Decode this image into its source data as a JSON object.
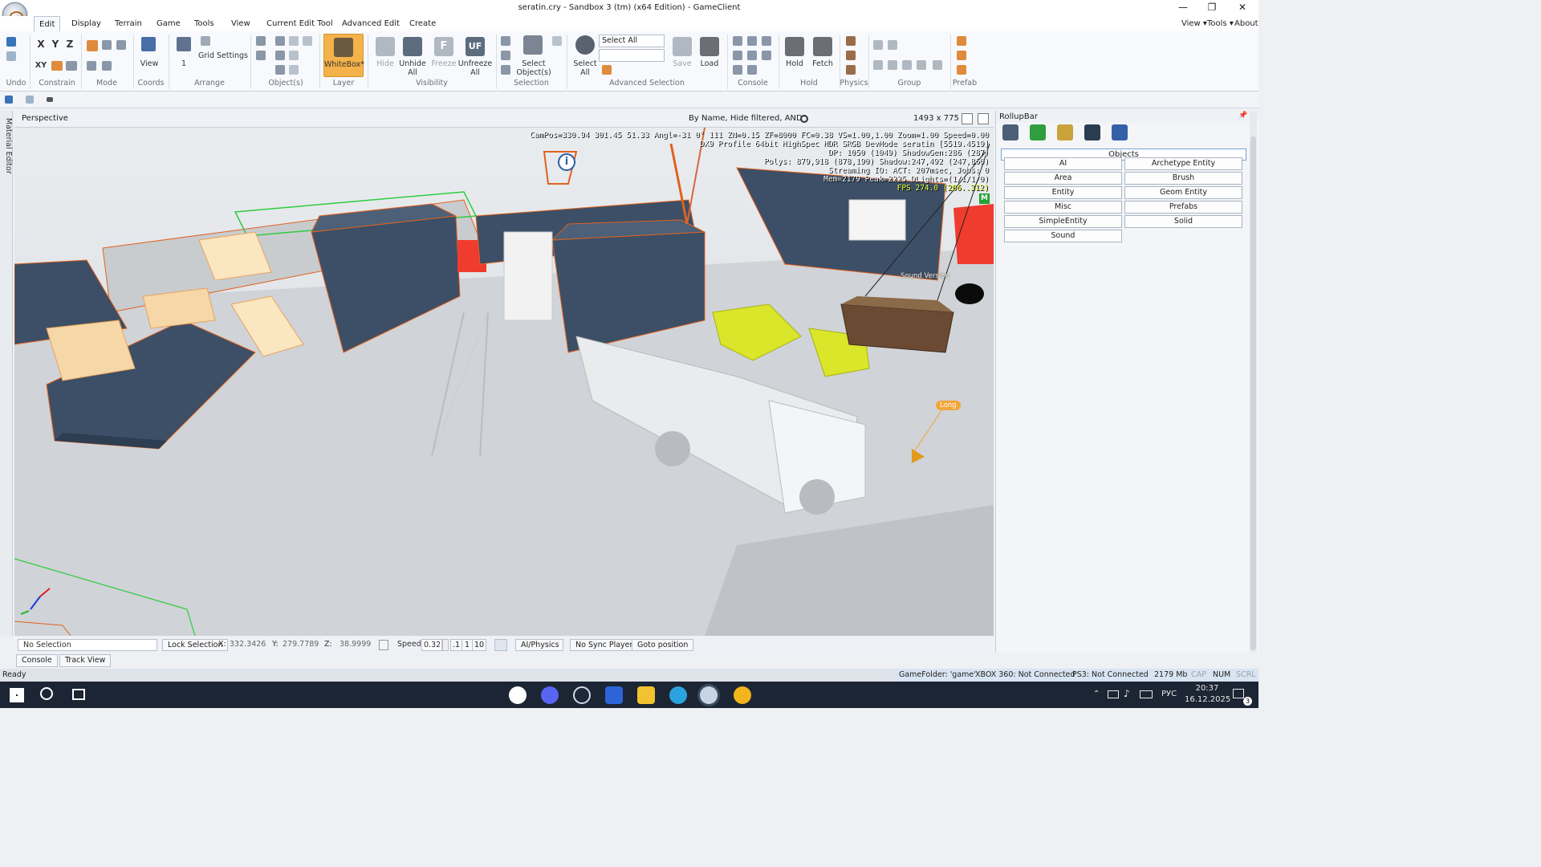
{
  "window": {
    "title": "seratin.cry - Sandbox 3 (tm) (x64 Edition) - GameClient",
    "controls": {
      "minimize": "—",
      "maximize": "❐",
      "close": "✕"
    }
  },
  "menu": {
    "tabs": [
      "Edit",
      "Display",
      "Terrain",
      "Game",
      "Tools",
      "View",
      "Current Edit Tool",
      "Advanced Edit",
      "Create"
    ],
    "active_tab": "Edit",
    "right": [
      "View ▾",
      "Tools ▾",
      "About"
    ]
  },
  "ribbon": {
    "groups": [
      "Undo",
      "Constrain",
      "Mode",
      "Coords",
      "Arrange",
      "Object(s)",
      "Layer",
      "Visibility",
      "Selection",
      "Advanced Selection",
      "Console",
      "Hold",
      "Physics",
      "Group",
      "Prefab"
    ],
    "constrain": {
      "x": "X",
      "y": "Y",
      "z": "Z",
      "xy": "XY"
    },
    "coords_button": "View",
    "arrange_value": "1",
    "grid_settings": "Grid Settings",
    "whitebox": "WhiteBox*",
    "visibility_buttons": [
      "Hide",
      "Unhide All",
      "Freeze",
      "Unfreeze All"
    ],
    "freeze_glyph": "F",
    "unfreeze_glyph": "UF",
    "selection_button": "Select Object(s)",
    "select_all_button": "Select All",
    "select_all_dropdown": "Select All",
    "save": "Save",
    "load": "Load",
    "hold": "Hold",
    "fetch": "Fetch"
  },
  "viewport": {
    "name": "Perspective",
    "filter": "By Name, Hide filtered, AND",
    "resolution": "1493 x 775",
    "hud_lines": [
      "CamPos=330.94 301.45 51.33 Angl=-31  0° 111 ZN=0.15 ZF=8000 FC=0.38 VS=1.00,1.00 Zoom=1.00 Speed=0.00",
      "DX9 Profile 64bit HighSpec HDR SRGB DevMode seratin [5519.4519]",
      "DP: 1050 (1049) ShadowGen:286 (287)",
      "Polys: 879,918 (878,190) Shadow:247,492 (247,860)",
      "Streaming IO: ACT: 207msec, Jobs: 0",
      "Mem=2179 Peak=2225 DLights=(1/1/1/0)"
    ],
    "fps": "FPS 274.0 (206..312)",
    "m_badge": "M",
    "label_tag": "Long",
    "info_glyph": "i",
    "world_label": "Sound Version"
  },
  "side_tab": "Material Editor",
  "rollup": {
    "title": "RollupBar",
    "pin": "📌",
    "close": "✕",
    "objects_header": "Objects",
    "buttons": [
      "AI",
      "Archetype Entity",
      "Area",
      "Brush",
      "Entity",
      "Geom Entity",
      "Misc",
      "Prefabs",
      "SimpleEntity",
      "Solid",
      "Sound"
    ]
  },
  "statusbar": {
    "selection": "No Selection",
    "lock_selection": "Lock Selection",
    "x_label": "X:",
    "x_value": "332.3426",
    "y_label": "Y:",
    "y_value": "279.7789",
    "z_label": "Z:",
    "z_value": "38.9999",
    "speed_label": "Speed:",
    "speed_value": "0.32",
    "speed_presets": [
      ".1",
      "1",
      "10"
    ],
    "ai_physics": "AI/Physics",
    "sync_player": "No Sync Player",
    "goto_position": "Goto position"
  },
  "console_tabs": [
    "Console",
    "Track View"
  ],
  "app_status": {
    "ready": "Ready",
    "game_folder": "GameFolder: 'game'",
    "xbox": "XBOX 360: Not Connected",
    "ps3": "PS3: Not Connected",
    "memory": "2179 Mb",
    "caps": "CAP",
    "num": "NUM",
    "scrl": "SCRL"
  },
  "taskbar": {
    "language": "РУС",
    "time": "20:37",
    "date": "16.12.2025",
    "notification_count": "3",
    "apps": [
      "yandex-browser",
      "discord",
      "steam",
      "xbox",
      "file-explorer",
      "telegram",
      "sandbox-editor",
      "photo-app"
    ]
  },
  "colors": {
    "crate_blue": "#3c4f66",
    "outline_orange": "#e0621e",
    "highlight_yellow": "#d9e62a",
    "fps_yellow": "#e8ff3a",
    "whitebox_orange": "#f4b24a",
    "taskbar_bg": "#1c2533"
  }
}
